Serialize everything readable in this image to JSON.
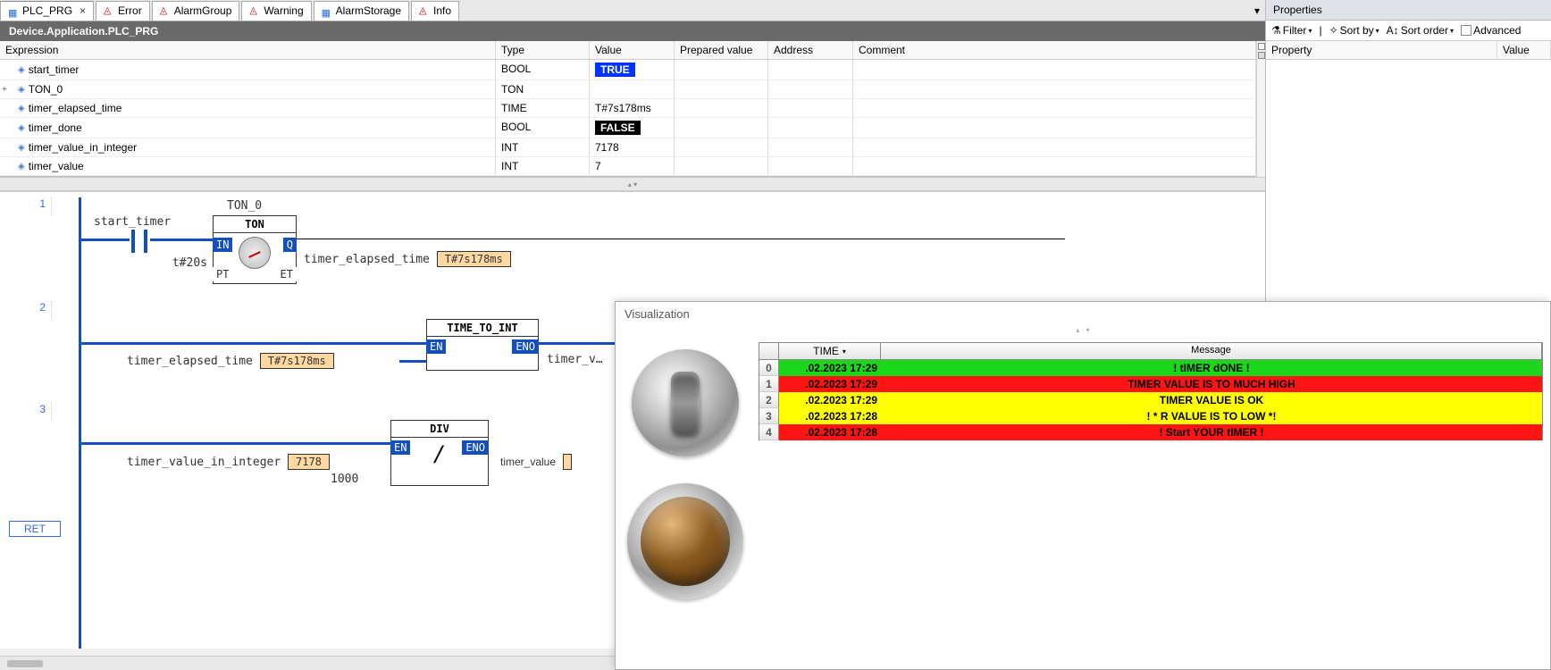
{
  "tabs": [
    {
      "label": "PLC_PRG",
      "icon": "box",
      "closable": true,
      "active": true
    },
    {
      "label": "Error",
      "icon": "warn"
    },
    {
      "label": "AlarmGroup",
      "icon": "warn"
    },
    {
      "label": "Warning",
      "icon": "warn"
    },
    {
      "label": "AlarmStorage",
      "icon": "box"
    },
    {
      "label": "Info",
      "icon": "warn"
    }
  ],
  "breadcrumb": "Device.Application.PLC_PRG",
  "vars": {
    "headers": {
      "expr": "Expression",
      "type": "Type",
      "value": "Value",
      "prep": "Prepared value",
      "addr": "Address",
      "comm": "Comment"
    },
    "rows": [
      {
        "expand": "",
        "name": "start_timer",
        "type": "BOOL",
        "value": "TRUE",
        "valstyle": "true"
      },
      {
        "expand": "+",
        "name": "TON_0",
        "type": "TON",
        "value": ""
      },
      {
        "expand": "",
        "name": "timer_elapsed_time",
        "type": "TIME",
        "value": "T#7s178ms"
      },
      {
        "expand": "",
        "name": "timer_done",
        "type": "BOOL",
        "value": "FALSE",
        "valstyle": "false"
      },
      {
        "expand": "",
        "name": "timer_value_in_integer",
        "type": "INT",
        "value": "7178"
      },
      {
        "expand": "",
        "name": "timer_value",
        "type": "INT",
        "value": "7"
      }
    ]
  },
  "fbd": {
    "rung1": {
      "contact_label": "start_timer",
      "block_name": "TON_0",
      "block_type": "TON",
      "pt_label": "t#20s",
      "et_label": "timer_elapsed_time",
      "et_val": "T#7s178ms",
      "ports": {
        "in": "IN",
        "q": "Q",
        "pt": "PT",
        "et": "ET"
      }
    },
    "rung2": {
      "block": "TIME_TO_INT",
      "in_label": "timer_elapsed_time",
      "in_val": "T#7s178ms",
      "out_label": "timer_v…",
      "ports": {
        "en": "EN",
        "eno": "ENO"
      }
    },
    "rung3": {
      "block": "DIV",
      "op": "/",
      "in_label": "timer_value_in_integer",
      "in_val": "7178",
      "const": "1000",
      "out_label": "timer_value",
      "ports": {
        "en": "EN",
        "eno": "ENO"
      }
    },
    "ret": "RET"
  },
  "props": {
    "panel": "Properties",
    "filter": "Filter",
    "sortby": "Sort by",
    "sortorder": "Sort order",
    "advanced": "Advanced",
    "col_prop": "Property",
    "col_val": "Value"
  },
  "viz": {
    "title": "Visualization",
    "cols": {
      "time": "TIME",
      "msg": "Message"
    },
    "rows": [
      {
        "idx": "0",
        "time": ".02.2023 17:29",
        "msg": "! tIMER dONE !",
        "color": "green"
      },
      {
        "idx": "1",
        "time": ".02.2023 17:29",
        "msg": "TIMER VALUE IS TO MUCH HIGH",
        "color": "red"
      },
      {
        "idx": "2",
        "time": ".02.2023 17:29",
        "msg": "TIMER VALUE IS OK",
        "color": "yellow"
      },
      {
        "idx": "3",
        "time": ".02.2023 17:28",
        "msg": "! * R VALUE IS TO LOW *!",
        "color": "yellow"
      },
      {
        "idx": "4",
        "time": ".02.2023 17:28",
        "msg": "! Start YOUR tIMER !",
        "color": "red"
      }
    ]
  }
}
